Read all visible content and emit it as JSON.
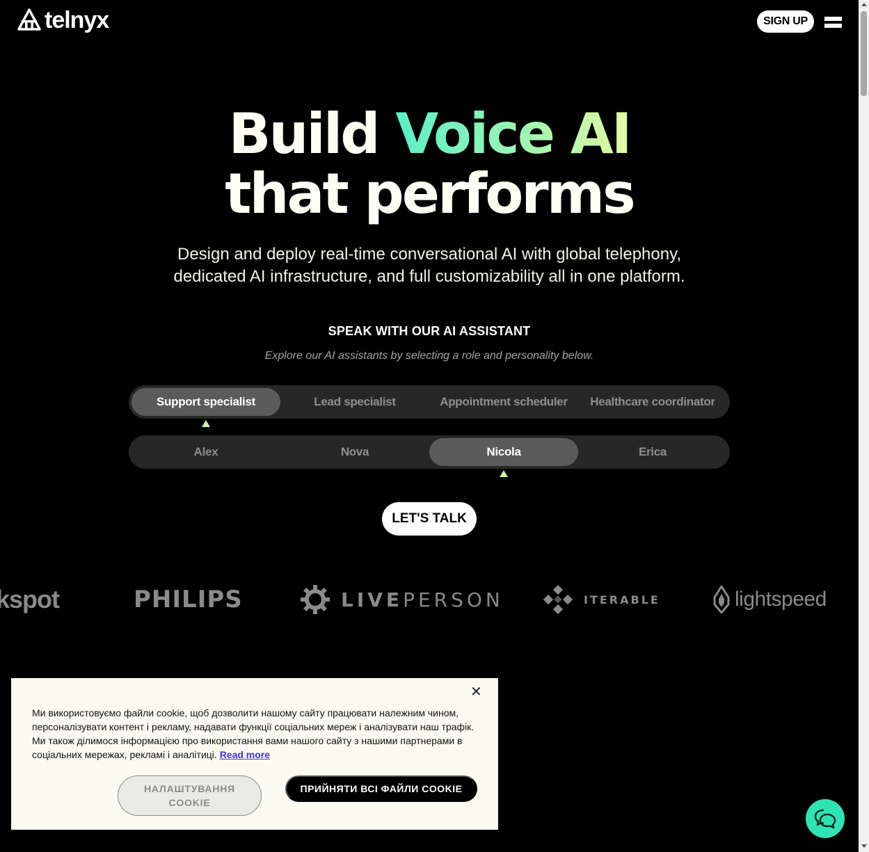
{
  "header": {
    "logo_text": "telnyx",
    "signup_label": "SIGN UP"
  },
  "hero": {
    "title_part1": "Build ",
    "title_highlight": "Voice AI",
    "title_line2": "that performs",
    "subtitle_line1": "Design and deploy real-time conversational AI with global telephony,",
    "subtitle_line2": "dedicated AI infrastructure, and full customizability all in one platform."
  },
  "assistant": {
    "heading": "SPEAK WITH OUR AI ASSISTANT",
    "subheading": "Explore our AI assistants by selecting a role and personality below.",
    "roles": [
      {
        "label": "Support specialist",
        "active": true
      },
      {
        "label": "Lead specialist",
        "active": false
      },
      {
        "label": "Appointment scheduler",
        "active": false
      },
      {
        "label": "Healthcare coordinator",
        "active": false
      }
    ],
    "personalities": [
      {
        "label": "Alex",
        "active": false
      },
      {
        "label": "Nova",
        "active": false
      },
      {
        "label": "Nicola",
        "active": true
      },
      {
        "label": "Erica",
        "active": false
      }
    ],
    "cta_label": "LET'S TALK",
    "pointer_color": "#c8f5a8"
  },
  "brands": {
    "hubspot": "kspot",
    "philips": "PHILIPS",
    "liveperson_bold": "LIVE",
    "liveperson_light": "PERSON",
    "iterable": "ITERABLE",
    "lightspeed": "lightspeed"
  },
  "cookie": {
    "text": "Ми використовуємо файли cookie, щоб дозволити нашому сайту працювати належним чином, персоналізувати контент і рекламу, надавати функції соціальних мереж і аналізувати наш трафік. Ми також ділимося інформацією про використання вами нашого сайту з нашими партнерами в соціальних мережах, рекламі і аналітиці.",
    "read_more": "Read more",
    "settings_label": "НАЛАШТУВАННЯ COOKIE",
    "accept_label": "ПРИЙНЯТИ ВСІ ФАЙЛИ COOKIE",
    "close_symbol": "✕"
  },
  "colors": {
    "accent_gradient_start": "#5af0c8",
    "accent_gradient_end": "#e4fba0",
    "chat_button": "#2fe4b4"
  }
}
